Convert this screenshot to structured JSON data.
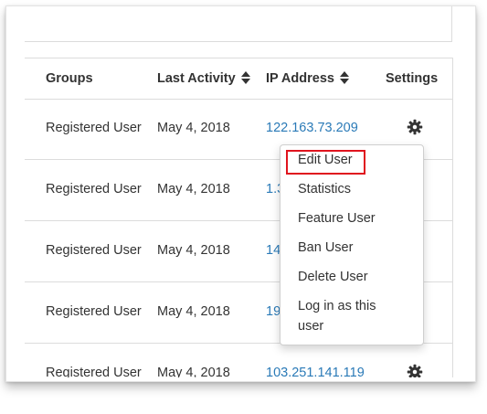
{
  "table": {
    "columns": [
      "Groups",
      "Last Activity",
      "IP Address",
      "Settings"
    ],
    "rows": [
      {
        "group": "Registered User",
        "activity": "May 4, 2018",
        "ip": "122.163.73.209"
      },
      {
        "group": "Registered User",
        "activity": "May 4, 2018",
        "ip": "1.3"
      },
      {
        "group": "Registered User",
        "activity": "May 4, 2018",
        "ip": "14"
      },
      {
        "group": "Registered User",
        "activity": "May 4, 2018",
        "ip": "19"
      },
      {
        "group": "Registered User",
        "activity": "May 4, 2018",
        "ip": "103.251.141.119"
      }
    ]
  },
  "settings_menu": {
    "items": [
      "Edit User",
      "Statistics",
      "Feature User",
      "Ban User",
      "Delete User",
      "Log in as this",
      "user"
    ]
  },
  "colors": {
    "link": "#2a7ab7",
    "highlight": "#e0141e",
    "text": "#333333"
  },
  "icons": {
    "sort": "sort-icon",
    "settings": "gear-icon"
  }
}
